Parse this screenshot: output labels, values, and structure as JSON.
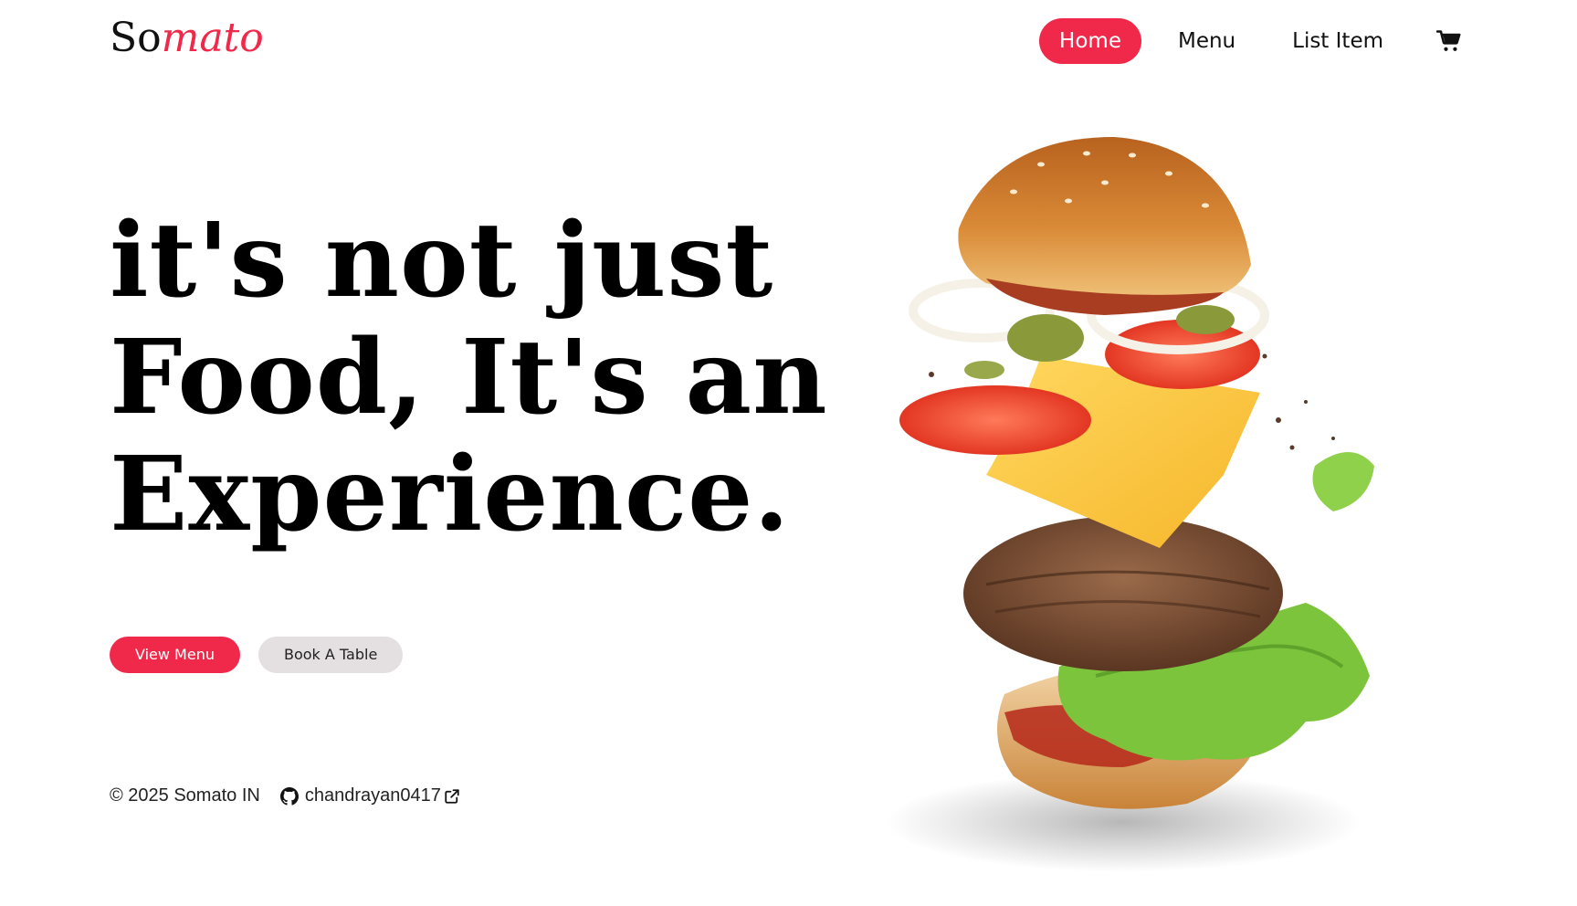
{
  "logo": {
    "part1": "So",
    "part2": "mato"
  },
  "nav": {
    "items": [
      {
        "label": "Home",
        "active": true
      },
      {
        "label": "Menu",
        "active": false
      },
      {
        "label": "List Item",
        "active": false
      }
    ],
    "cart_icon": "cart-icon"
  },
  "hero": {
    "line1": "it's not just",
    "line2": "Food, It's an",
    "line3": "Experience.",
    "primary_button": "View Menu",
    "secondary_button": "Book A Table",
    "image": "burger-illustration"
  },
  "footer": {
    "copyright": "© 2025 Somato IN",
    "github_user": "chandrayan0417",
    "github_icon": "github-icon",
    "external_icon": "external-link-icon"
  },
  "colors": {
    "accent": "#f0284a",
    "secondary_button_bg": "#e4dfe0"
  }
}
